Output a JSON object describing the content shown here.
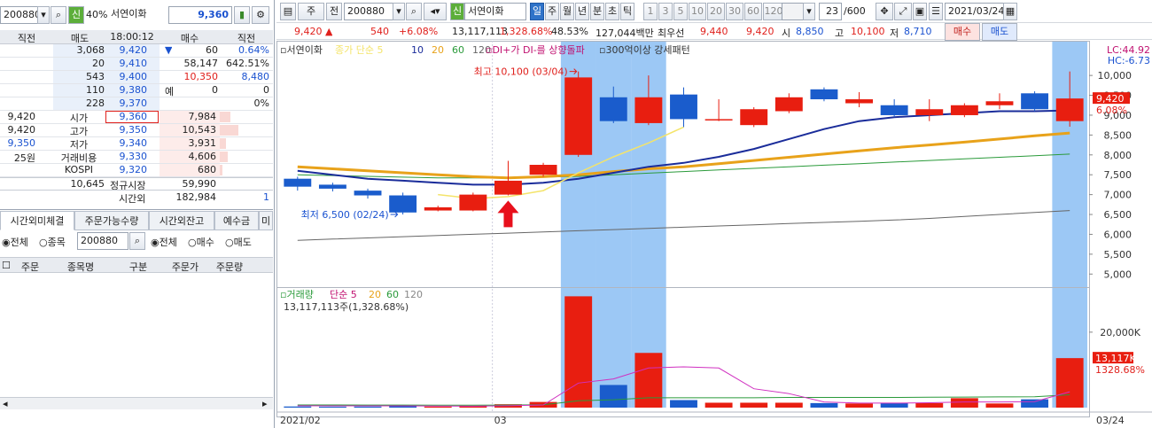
{
  "left": {
    "code": "200880",
    "margin": "40%",
    "margin_badge": "신",
    "name": "서연이화",
    "price": "9,360",
    "headers": [
      "직전",
      "매도",
      "18:00:12",
      "매수",
      "직전"
    ],
    "asks": [
      {
        "prev": "",
        "qty": "3,068",
        "price": "9,420",
        "bidqty": "▼",
        "bidprev": "60",
        "chg": "0.64%"
      },
      {
        "prev": "",
        "qty": "20",
        "price": "9,410",
        "bidqty": "",
        "bidprev": "58,147",
        "chg": "642.51%"
      },
      {
        "prev": "",
        "qty": "543",
        "price": "9,400",
        "bidqty": "",
        "bidprev": "10,350",
        "chg": "8,480"
      },
      {
        "prev": "",
        "qty": "110",
        "price": "9,380",
        "bidqty": "예",
        "bidprev": "0",
        "chg": "0"
      },
      {
        "prev": "",
        "qty": "228",
        "price": "9,370",
        "bidqty": "",
        "bidprev": "",
        "chg": "0%"
      }
    ],
    "bids": [
      {
        "label_val": "9,420",
        "label": "시가",
        "price": "9,360",
        "qty": "7,984"
      },
      {
        "label_val": "9,420",
        "label": "고가",
        "price": "9,350",
        "qty": "10,543"
      },
      {
        "label_val": "9,350",
        "label": "저가",
        "price": "9,340",
        "qty": "3,931"
      },
      {
        "label_val": "25원",
        "label": "거래비용",
        "price": "9,330",
        "qty": "4,606"
      },
      {
        "label_val": "",
        "label": "KOSPI",
        "price": "9,320",
        "qty": "680"
      }
    ],
    "total_ask": "10,645",
    "session_label": "정규시장",
    "total_bid": "59,990",
    "after_label": "시간외",
    "after_qty": "182,984",
    "after_right": "1",
    "tabs": [
      "시간외미체결",
      "주문가능수량",
      "시간외잔고",
      "예수금",
      "미"
    ],
    "filter": {
      "all": "전체",
      "item": "종목",
      "code": "200880",
      "all2": "전체",
      "buy": "매수",
      "sell": "매도"
    },
    "cols": [
      "주문",
      "종목명",
      "구분",
      "주문가",
      "주문량"
    ]
  },
  "right": {
    "period_sel": "주",
    "prev": "전",
    "code": "200880",
    "badge": "신",
    "name": "서연이화",
    "periods": [
      "일",
      "주",
      "월",
      "년",
      "분",
      "초",
      "틱"
    ],
    "nums": [
      "1",
      "3",
      "5",
      "10",
      "20",
      "30",
      "60",
      "120"
    ],
    "count": "23",
    "count_total": "/600",
    "date": "2021/03/24",
    "info": {
      "price": "9,420",
      "arrow": "▲",
      "chg": "540",
      "pct": "+6.08%",
      "vol": "13,117,113",
      "volpct": "1,328.68%",
      "turn": "48.53%",
      "amt": "127,044백만",
      "pref_label": "최우선",
      "ask": "9,440",
      "bid": "9,420",
      "open_label": "시",
      "open": "8,850",
      "high_label": "고",
      "high": "10,100",
      "low_label": "저",
      "low": "8,710",
      "buy": "매수",
      "sell": "매도"
    }
  },
  "chart_data": {
    "type": "candlestick",
    "legend": {
      "name": "서연이화",
      "ma_label": "종가 단순",
      "ma": [
        "5",
        "10",
        "20",
        "60",
        "120"
      ],
      "ind1": "DI+가 DI-를 상향돌파",
      "ind2": "300억이상 강세패턴"
    },
    "corner": {
      "lc": "LC:44.92",
      "hc": "HC:-6.73"
    },
    "y_ticks": [
      5000,
      5500,
      6000,
      6500,
      7000,
      7500,
      8000,
      8500,
      9000,
      9500,
      10000
    ],
    "y_tick_labels": [
      "5,000",
      "5,500",
      "6,000",
      "6,500",
      "7,000",
      "7,500",
      "8,000",
      "8,500",
      "9,000",
      "9,500",
      "10,000"
    ],
    "ylim": [
      4850,
      10650
    ],
    "candles": [
      {
        "o": 7400,
        "c": 7200,
        "h": 7450,
        "l": 7100
      },
      {
        "o": 7250,
        "c": 7150,
        "h": 7300,
        "l": 7080
      },
      {
        "o": 7100,
        "c": 6980,
        "h": 7150,
        "l": 6900
      },
      {
        "o": 6980,
        "c": 6550,
        "h": 7050,
        "l": 6500
      },
      {
        "o": 6600,
        "c": 6680,
        "h": 6720,
        "l": 6580
      },
      {
        "o": 6600,
        "c": 7000,
        "h": 7050,
        "l": 6580
      },
      {
        "o": 7000,
        "c": 7350,
        "h": 7850,
        "l": 6980
      },
      {
        "o": 7500,
        "c": 7750,
        "h": 7800,
        "l": 7450
      },
      {
        "o": 8000,
        "c": 9950,
        "h": 10100,
        "l": 7950
      },
      {
        "o": 9450,
        "c": 8850,
        "h": 9720,
        "l": 8800
      },
      {
        "o": 8800,
        "c": 9450,
        "h": 10000,
        "l": 8750
      },
      {
        "o": 9520,
        "c": 8900,
        "h": 9700,
        "l": 8700
      },
      {
        "o": 8900,
        "c": 8900,
        "h": 9400,
        "l": 8850
      },
      {
        "o": 8750,
        "c": 9150,
        "h": 9200,
        "l": 8700
      },
      {
        "o": 9100,
        "c": 9450,
        "h": 9550,
        "l": 9050
      },
      {
        "o": 9650,
        "c": 9400,
        "h": 9700,
        "l": 9350
      },
      {
        "o": 9300,
        "c": 9400,
        "h": 9580,
        "l": 9200
      },
      {
        "o": 9250,
        "c": 9000,
        "h": 9400,
        "l": 8950
      },
      {
        "o": 9000,
        "c": 9150,
        "h": 9400,
        "l": 8850
      },
      {
        "o": 9000,
        "c": 9250,
        "h": 9300,
        "l": 8950
      },
      {
        "o": 9250,
        "c": 9350,
        "h": 9550,
        "l": 9150
      },
      {
        "o": 9550,
        "c": 9150,
        "h": 9600,
        "l": 9100
      },
      {
        "o": 8850,
        "c": 9420,
        "h": 10100,
        "l": 8710
      }
    ],
    "ma5": [
      null,
      null,
      null,
      null,
      7000,
      6900,
      6950,
      7100,
      7550,
      7950,
      8300,
      8700,
      null,
      null,
      null,
      null,
      null,
      null,
      null,
      null,
      null,
      null,
      null
    ],
    "ma10": [
      7600,
      7500,
      7400,
      7350,
      7300,
      7250,
      7250,
      7300,
      7400,
      7550,
      7700,
      7800,
      7950,
      8150,
      8400,
      8650,
      8850,
      8950,
      9000,
      9050,
      9100,
      9100,
      9120
    ],
    "ma20": [
      7700,
      7650,
      7600,
      7550,
      7500,
      7450,
      7420,
      7450,
      7500,
      7580,
      7650,
      7700,
      7780,
      7860,
      7940,
      8020,
      8100,
      8180,
      8250,
      8320,
      8400,
      8480,
      8550
    ],
    "ma60": [
      7500,
      7480,
      7460,
      7440,
      7420,
      7420,
      7420,
      7440,
      7460,
      7500,
      7540,
      7580,
      7620,
      7660,
      7700,
      7740,
      7780,
      7820,
      7860,
      7900,
      7940,
      7980,
      8020
    ],
    "ma120": [
      5850,
      5880,
      5910,
      5940,
      5970,
      6000,
      6030,
      6060,
      6090,
      6120,
      6150,
      6180,
      6210,
      6240,
      6270,
      6300,
      6330,
      6360,
      6400,
      6450,
      6500,
      6550,
      6600
    ],
    "highlight": [
      8,
      9,
      10,
      22
    ],
    "annotations": {
      "high": "최고 10,100 (03/04)",
      "low": "최저 6,500 (02/24)"
    },
    "price_flag": "9,420",
    "pct_flag": "6.08%",
    "volume": {
      "label": "거래량",
      "ma_label": "단순",
      "ma": [
        "5",
        "20",
        "60",
        "120"
      ],
      "value_text": "13,117,113주(1,328.68%)",
      "tick": "20,000K",
      "flag": "13,117K",
      "pct_flag": "1328.68%",
      "values": [
        300,
        250,
        280,
        420,
        280,
        500,
        900,
        1500,
        29500,
        6000,
        14500,
        2000,
        1300,
        1300,
        1300,
        1200,
        1100,
        1200,
        1200,
        2500,
        1100,
        2200,
        13117
      ],
      "ma5": [
        500,
        480,
        470,
        460,
        420,
        380,
        500,
        700,
        6500,
        7600,
        10500,
        10800,
        10500,
        5000,
        3700,
        1500,
        1200,
        1200,
        1300,
        1500,
        1500,
        1600,
        4200
      ],
      "ma20": [
        700,
        700,
        690,
        680,
        660,
        650,
        680,
        750,
        1800,
        2100,
        2600,
        2600,
        2600,
        2600,
        2700,
        2700,
        2700,
        2700,
        2750,
        2800,
        2850,
        2900,
        3400
      ],
      "ylim": [
        0,
        31000
      ]
    },
    "x_labels": [
      "2021/02",
      "03",
      "03/24"
    ]
  }
}
